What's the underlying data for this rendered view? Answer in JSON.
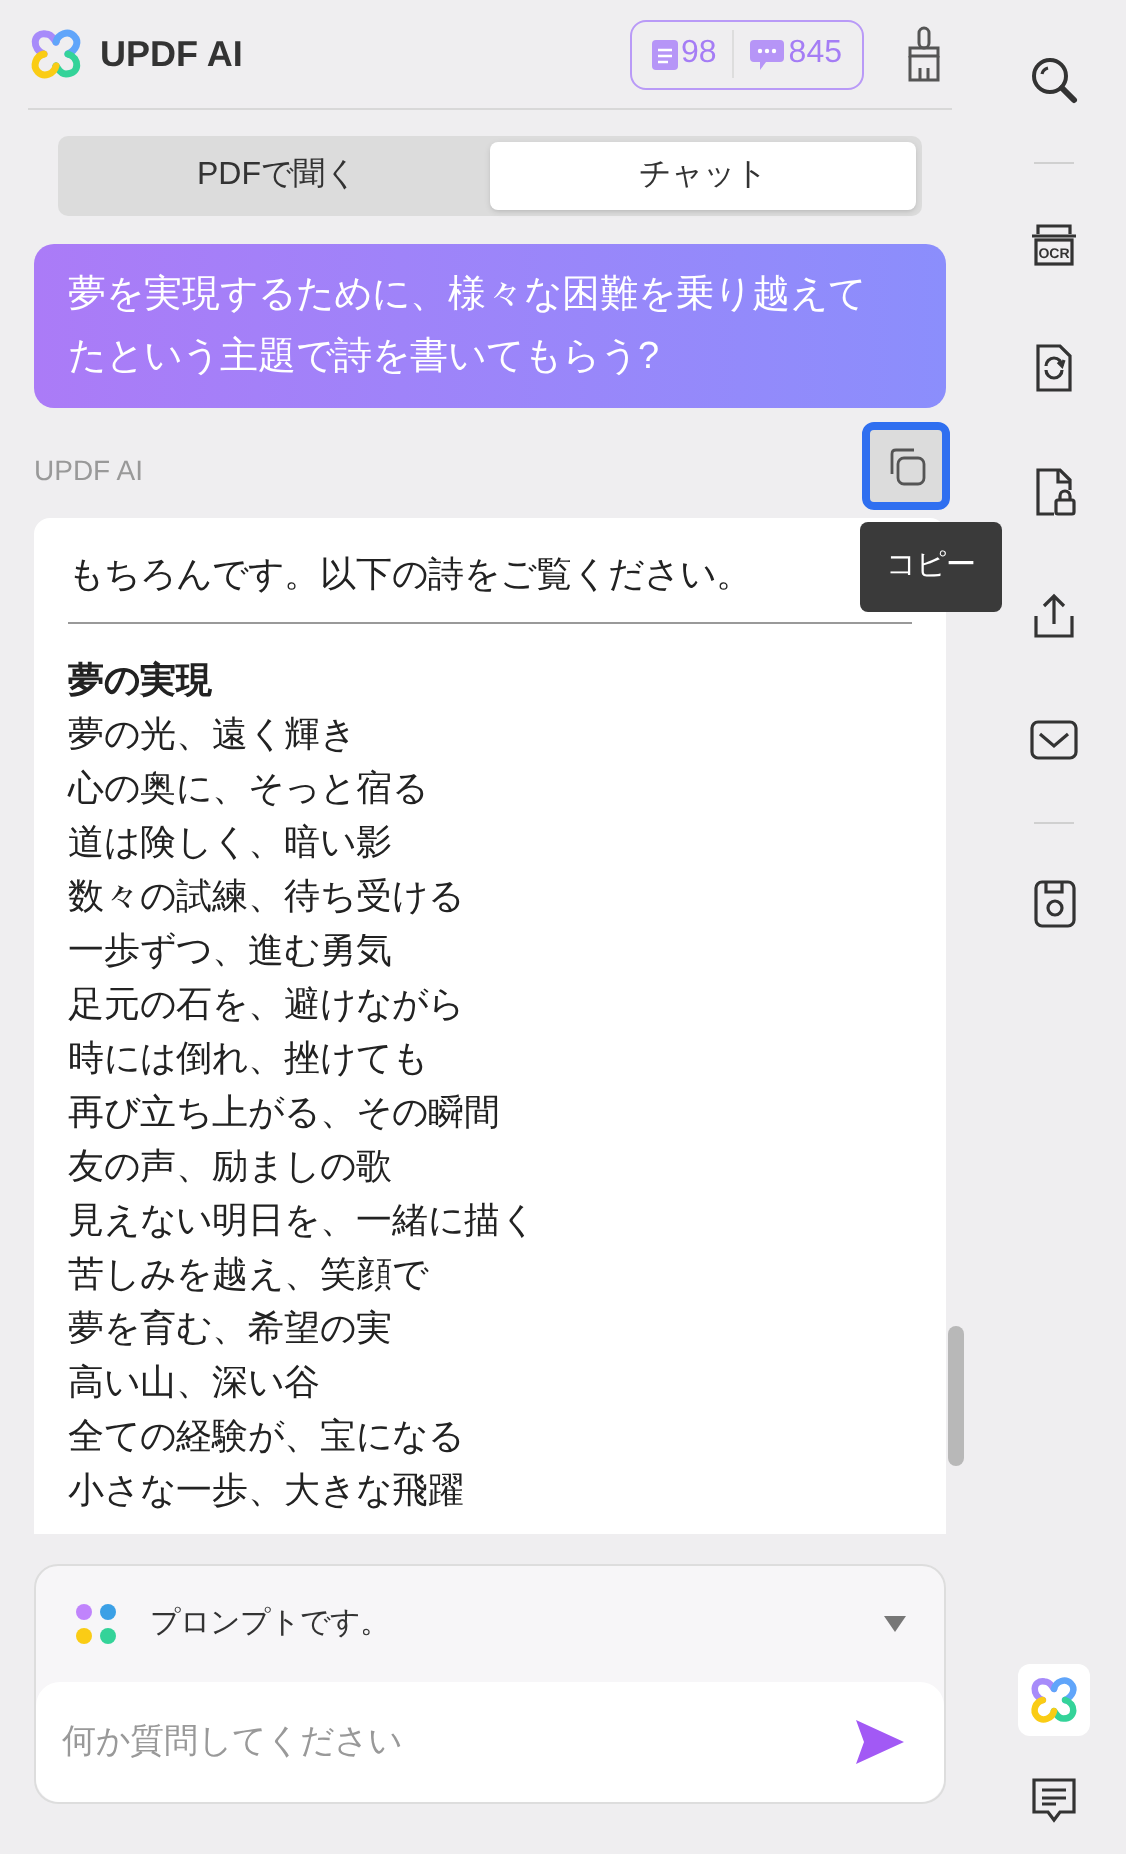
{
  "header": {
    "title": "UPDF AI",
    "counters": [
      {
        "kind": "document",
        "value": "98"
      },
      {
        "kind": "chat",
        "value": "845"
      }
    ]
  },
  "tabs": [
    {
      "label": "PDFで聞く",
      "selected": false
    },
    {
      "label": "チャット",
      "selected": true
    }
  ],
  "user_message": "夢を実現するために、様々な困難を乗り越えてたという主題で詩を書いてもらう?",
  "ai_label": "UPDF AI",
  "copy_button": {
    "tooltip": "コピー"
  },
  "answer": {
    "intro": "もちろんです。以下の詩をご覧ください。",
    "poem_title": "夢の実現",
    "lines": [
      "夢の光、遠く輝き",
      "心の奥に、そっと宿る",
      "道は険しく、暗い影",
      "数々の試練、待ち受ける",
      "一歩ずつ、進む勇気",
      "足元の石を、避けながら",
      "時には倒れ、挫けても",
      "再び立ち上がる、その瞬間",
      "友の声、励ましの歌",
      "見えない明日を、一緒に描く",
      "苦しみを越え、笑顔で",
      "夢を育む、希望の実",
      "高い山、深い谷",
      "全ての経験が、宝になる",
      "小さな一歩、大きな飛躍"
    ]
  },
  "prompt_selector": {
    "label": "プロンプトです。"
  },
  "input": {
    "placeholder": "何か質問してください"
  },
  "sidebar": [
    {
      "kind": "search"
    },
    {
      "kind": "divider"
    },
    {
      "kind": "ocr",
      "label": "OCR"
    },
    {
      "kind": "convert"
    },
    {
      "kind": "protect"
    },
    {
      "kind": "share"
    },
    {
      "kind": "mail"
    },
    {
      "kind": "divider"
    },
    {
      "kind": "save"
    }
  ]
}
